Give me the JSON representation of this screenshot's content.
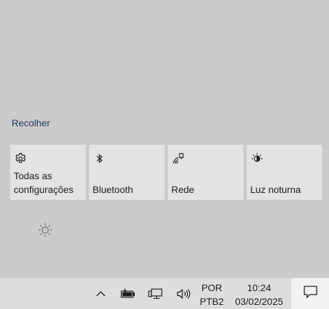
{
  "action_center": {
    "collapse_label": "Recolher",
    "tiles": [
      {
        "label": "Todas as configurações",
        "icon": "gear-icon"
      },
      {
        "label": "Bluetooth",
        "icon": "bluetooth-icon"
      },
      {
        "label": "Rede",
        "icon": "network-icon"
      },
      {
        "label": "Luz noturna",
        "icon": "night-light-icon"
      }
    ],
    "brightness_icon": "brightness-icon"
  },
  "taskbar": {
    "icons": [
      "chevron-up-icon",
      "battery-icon",
      "network-icon",
      "speaker-icon"
    ],
    "language": {
      "line1": "POR",
      "line2": "PTB2"
    },
    "clock": {
      "time": "10:24",
      "date": "03/02/2025"
    },
    "notifications_icon": "notification-icon"
  },
  "colors": {
    "background": "#cacaca",
    "tile": "#e3e3e3",
    "taskbar": "#dddddd",
    "link": "#1f3a5a"
  }
}
